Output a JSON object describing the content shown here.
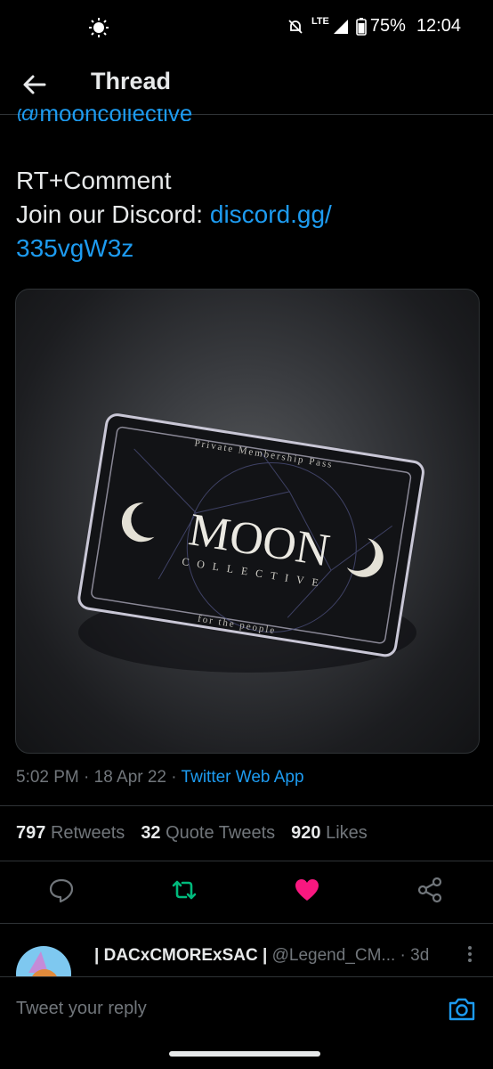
{
  "status_bar": {
    "lte": "LTE",
    "battery": "75%",
    "time": "12:04"
  },
  "header": {
    "title": "Thread"
  },
  "tweet": {
    "cut_handle": "@mooncollective",
    "line1": "RT+Comment",
    "line2_prefix": "Join our Discord: ",
    "line2_link": "discord.gg/",
    "line3_link": "335vgW3z",
    "image": {
      "top_text": "Private Membership Pass",
      "brand": "MOON",
      "sub": "COLLECTIVE",
      "bottom_text": "for the people"
    },
    "time": "5:02 PM",
    "date": "18 Apr 22",
    "source": "Twitter Web App",
    "stats": {
      "retweets_count": "797",
      "retweets_label": "Retweets",
      "quotes_count": "32",
      "quotes_label": "Quote Tweets",
      "likes_count": "920",
      "likes_label": "Likes"
    }
  },
  "reply": {
    "name": "| DACxCMORExSAC |",
    "handle": "@Legend_CM...",
    "age": "· 3d"
  },
  "compose": {
    "placeholder": "Tweet your reply"
  },
  "colors": {
    "accent": "#1d9bf0",
    "like": "#f91880",
    "retweet": "#00ba7c"
  }
}
